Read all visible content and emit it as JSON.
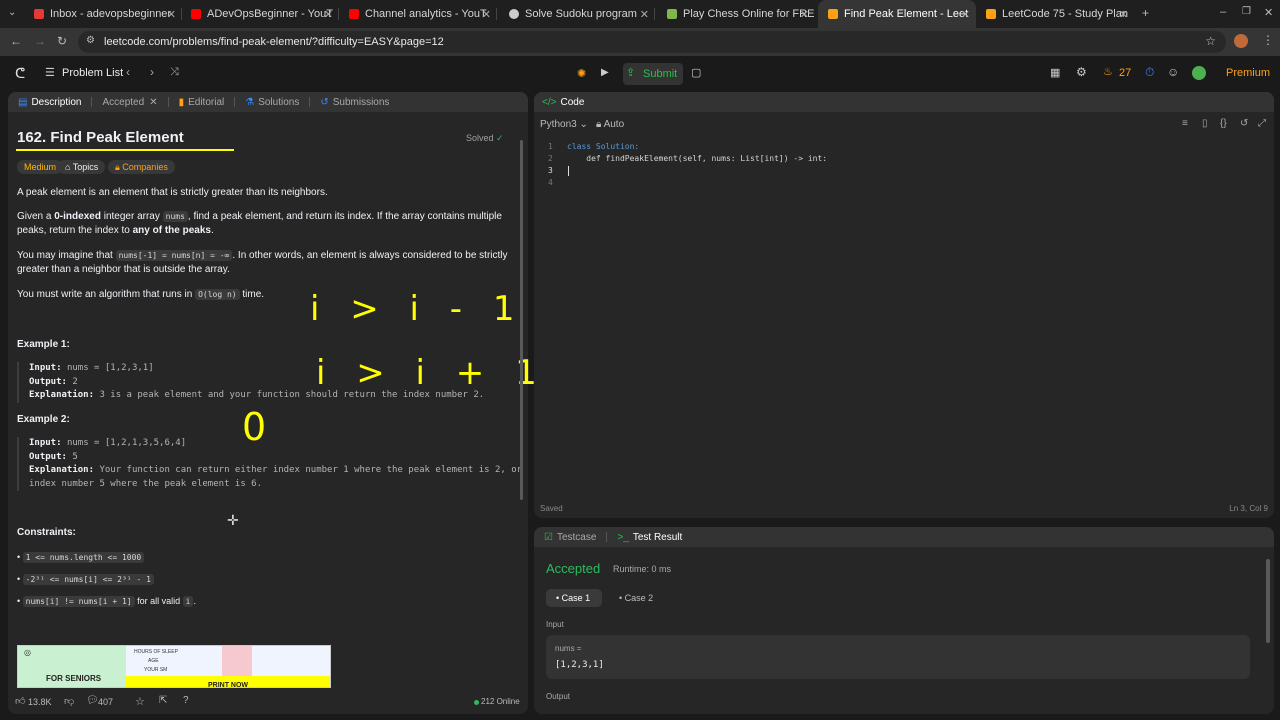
{
  "browser": {
    "tabs": [
      {
        "title": "Inbox - adevopsbeginner",
        "favicon_color": "#e53935"
      },
      {
        "title": "ADevOpsBeginner - YouT",
        "favicon_color": "#ff0000"
      },
      {
        "title": "Channel analytics - YouT",
        "favicon_color": "#ff0000"
      },
      {
        "title": "Solve Sudoku program",
        "favicon_color": "#cccccc"
      },
      {
        "title": "Play Chess Online for FRE",
        "favicon_color": "#81b64c"
      },
      {
        "title": "Find Peak Element - Leet",
        "favicon_color": "#ffa116"
      },
      {
        "title": "LeetCode 75 - Study Plan",
        "favicon_color": "#ffa116"
      }
    ],
    "url": "leetcode.com/problems/find-peak-element/?difficulty=EASY&page=12"
  },
  "nav": {
    "problem_list": "Problem List",
    "submit": "Submit",
    "streak": "27",
    "premium": "Premium"
  },
  "description_panel": {
    "tabs": [
      "Description",
      "Accepted",
      "Editorial",
      "Solutions",
      "Submissions"
    ],
    "title": "162. Find Peak Element",
    "solved": "Solved",
    "chips": [
      "Medium",
      "Topics",
      "Companies"
    ],
    "p1": "A peak element is an element that is strictly greater than its neighbors.",
    "p2_a": "Given a ",
    "p2_bold": "0-indexed",
    "p2_b": " integer array ",
    "p2_code": "nums",
    "p2_c": ", find a peak element, and return its index. If the array contains multiple peaks, return the index to ",
    "p2_bold2": "any of the peaks",
    "p2_d": ".",
    "p3_a": "You may imagine that ",
    "p3_code": "nums[-1] = nums[n] = -∞",
    "p3_b": ". In other words, an element is always considered to be strictly greater than a neighbor that is outside the array.",
    "p4_a": "You must write an algorithm that runs in ",
    "p4_code": "O(log n)",
    "p4_b": " time.",
    "example1_title": "Example 1:",
    "example1": {
      "input_label": "Input:",
      "input": "nums = [1,2,3,1]",
      "output_label": "Output:",
      "output": "2",
      "explanation_label": "Explanation:",
      "explanation": "3 is a peak element and your function should return the index number 2."
    },
    "example2_title": "Example 2:",
    "example2": {
      "input_label": "Input:",
      "input": "nums = [1,2,1,3,5,6,4]",
      "output_label": "Output:",
      "output": "5",
      "explanation_label": "Explanation:",
      "explanation": "Your function can return either index number 1 where the peak element is 2, or index number 5 where the peak element is 6."
    },
    "constraints_title": "Constraints:",
    "constraints": [
      "1 <= nums.length <= 1000",
      "-2³¹ <= nums[i] <= 2³¹ - 1",
      "nums[i] != nums[i + 1]"
    ],
    "constraint3_suffix": " for all valid ",
    "constraint3_code": "i",
    "constraint3_end": ".",
    "ad": {
      "left_label": "FOR SENIORS",
      "right_label": "PRINT NOW",
      "table_header": "HOURS OF SLEEP",
      "row1": "AGE",
      "row2": "YOUR SM"
    },
    "footer": {
      "likes": "13.8K",
      "comments": "407",
      "online": "212 Online"
    },
    "handwriting": [
      "i > i - 1",
      "i > i + 1",
      "0"
    ]
  },
  "code_panel": {
    "title": "Code",
    "language": "Python3",
    "auto": "Auto",
    "lines": [
      "class Solution:",
      "    def findPeakElement(self, nums: List[int]) -> int:",
      "",
      ""
    ],
    "line_numbers": [
      "1",
      "2",
      "3",
      "4"
    ],
    "saved": "Saved",
    "cursor": "Ln 3, Col 9"
  },
  "result_panel": {
    "tabs": [
      "Testcase",
      "Test Result"
    ],
    "status": "Accepted",
    "runtime": "Runtime: 0 ms",
    "cases": [
      "Case 1",
      "Case 2"
    ],
    "input_label": "Input",
    "var_name": "nums =",
    "var_value": "[1,2,3,1]",
    "output_label": "Output"
  },
  "colors": {
    "accepted": "#2cbb5d",
    "medium": "#ffb800",
    "highlight": "#ffff00",
    "submit": "#28c244",
    "premium": "#ffa116"
  }
}
